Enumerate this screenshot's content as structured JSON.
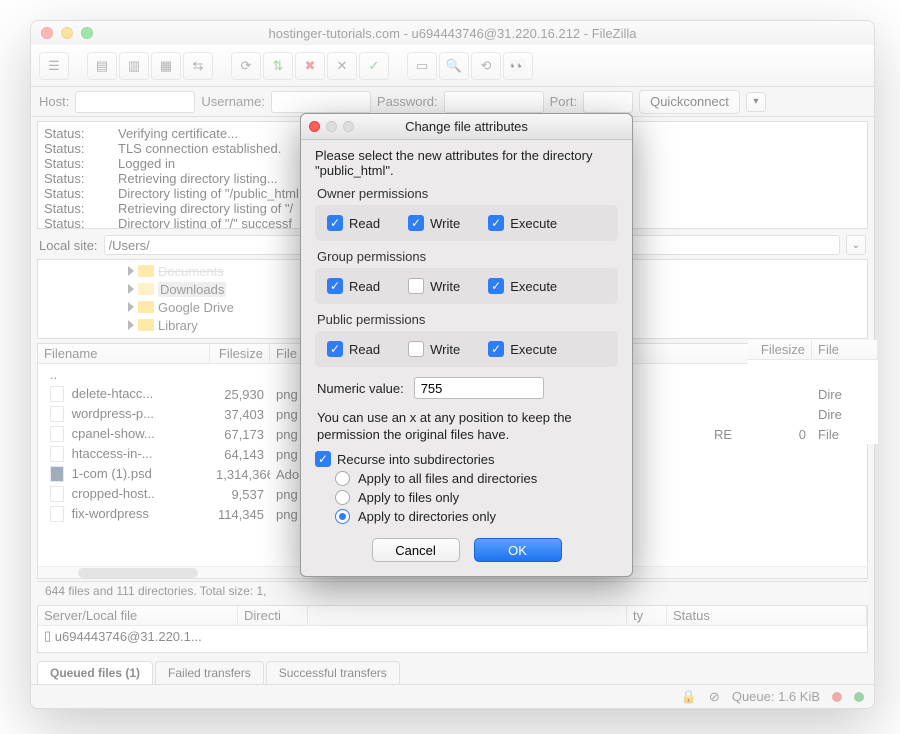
{
  "title": "hostinger-tutorials.com - u694443746@31.220.16.212 - FileZilla",
  "quickbar": {
    "host": "Host:",
    "user": "Username:",
    "pass": "Password:",
    "port": "Port:",
    "btn": "Quickconnect"
  },
  "log": [
    {
      "lab": "Status:",
      "msg": "Verifying certificate..."
    },
    {
      "lab": "Status:",
      "msg": "TLS connection established."
    },
    {
      "lab": "Status:",
      "msg": "Logged in"
    },
    {
      "lab": "Status:",
      "msg": "Retrieving directory listing..."
    },
    {
      "lab": "Status:",
      "msg": "Directory listing of \"/public_html"
    },
    {
      "lab": "Status:",
      "msg": "Retrieving directory listing of \"/"
    },
    {
      "lab": "Status:",
      "msg": "Directory listing of \"/\" successf"
    }
  ],
  "localsite_label": "Local site:",
  "localsite_value": "/Users/",
  "tree": [
    "Downloads",
    "Google Drive",
    "Library"
  ],
  "tree_hidden": "Documents",
  "listheaders": {
    "name": "Filename",
    "size": "Filesize",
    "type": "File"
  },
  "remoteheaders": {
    "size": "Filesize",
    "type": "File"
  },
  "files": [
    {
      "name": "..",
      "size": "",
      "type": ""
    },
    {
      "name": "delete-htacc...",
      "size": "25,930",
      "type": "png"
    },
    {
      "name": "wordpress-p...",
      "size": "37,403",
      "type": "png"
    },
    {
      "name": "cpanel-show...",
      "size": "67,173",
      "type": "png"
    },
    {
      "name": "htaccess-in-...",
      "size": "64,143",
      "type": "png"
    },
    {
      "name": "1-com (1).psd",
      "size": "1,314,366",
      "type": "Ado",
      "icon": "ps"
    },
    {
      "name": "cropped-host..",
      "size": "9,537",
      "type": "png"
    },
    {
      "name": "fix-wordpress",
      "size": "114,345",
      "type": "png"
    }
  ],
  "remote_rows": [
    {
      "size": "",
      "type": "Dire"
    },
    {
      "size": "",
      "type": "Dire"
    },
    {
      "size": "0",
      "type": "File"
    }
  ],
  "remote_extra": "RE",
  "status_strip": "644 files and 111 directories. Total size: 1,",
  "queue": {
    "headers": [
      "Server/Local file",
      "Directi",
      "ty",
      "Status"
    ],
    "row": "u694443746@31.220.1..."
  },
  "tabs": [
    "Queued files (1)",
    "Failed transfers",
    "Successful transfers"
  ],
  "bottombar": {
    "queue": "Queue: 1.6 KiB"
  },
  "dialog": {
    "title": "Change file attributes",
    "intro": "Please select the new attributes for the directory \"public_html\".",
    "owner_label": "Owner permissions",
    "group_label": "Group permissions",
    "public_label": "Public permissions",
    "perms": {
      "read": "Read",
      "write": "Write",
      "exec": "Execute"
    },
    "owner": {
      "read": true,
      "write": true,
      "exec": true
    },
    "group": {
      "read": true,
      "write": false,
      "exec": true
    },
    "public": {
      "read": true,
      "write": false,
      "exec": true
    },
    "numlabel": "Numeric value:",
    "numvalue": "755",
    "note": "You can use an x at any position to keep the permission the original files have.",
    "recurse": "Recurse into subdirectories",
    "recurse_on": true,
    "radios": [
      "Apply to all files and directories",
      "Apply to files only",
      "Apply to directories only"
    ],
    "radio_sel": 2,
    "cancel": "Cancel",
    "ok": "OK"
  }
}
